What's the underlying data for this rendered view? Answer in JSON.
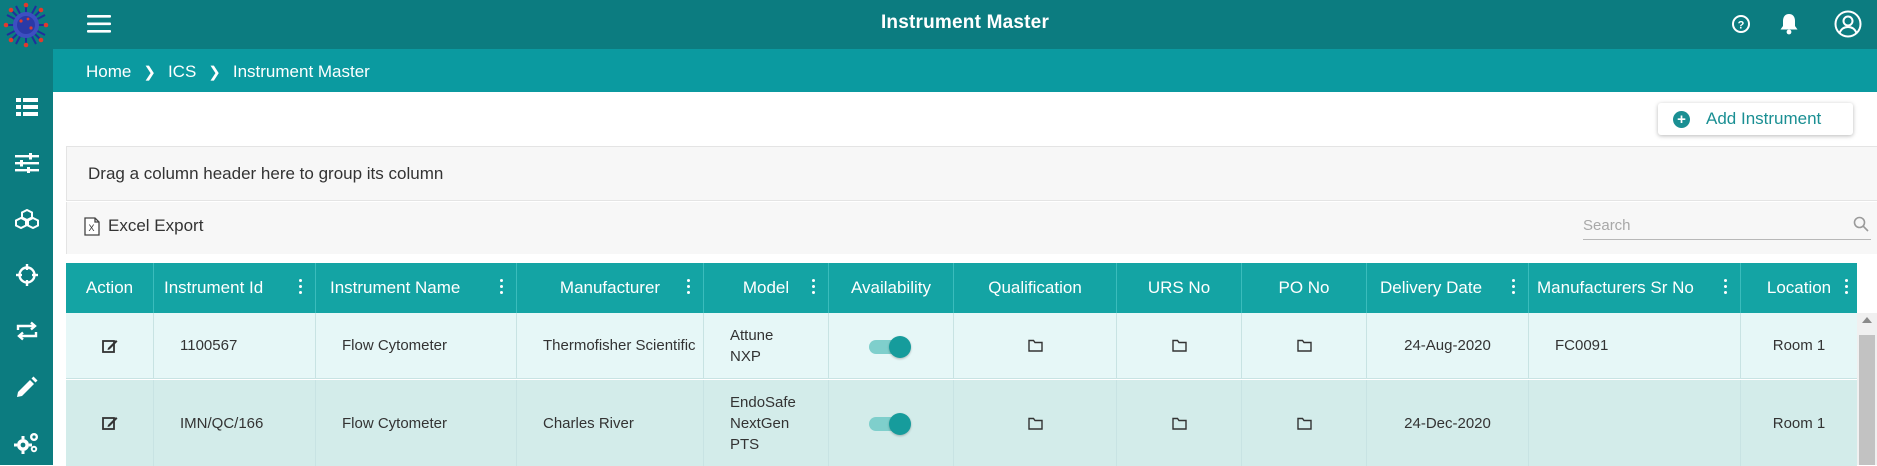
{
  "app": {
    "title": "Instrument Master"
  },
  "breadcrumb": [
    "Home",
    "ICS",
    "Instrument Master"
  ],
  "sidebar": {
    "icons": [
      "list-icon",
      "sliders-icon",
      "cubes-icon",
      "crosshair-icon",
      "sync-icon",
      "pencil-icon",
      "cogs-icon"
    ]
  },
  "topbar": {
    "icons": [
      "menu-icon",
      "help-icon",
      "bell-icon",
      "user-icon"
    ]
  },
  "toolbar": {
    "add_label": "Add Instrument",
    "group_hint": "Drag a column header here to group its column",
    "excel_label": "Excel Export",
    "search_placeholder": "Search"
  },
  "grid": {
    "columns": [
      {
        "label": "Action",
        "menu": false
      },
      {
        "label": "Instrument Id",
        "menu": true
      },
      {
        "label": "Instrument Name",
        "menu": true
      },
      {
        "label": "Manufacturer",
        "menu": true
      },
      {
        "label": "Model",
        "menu": true
      },
      {
        "label": "Availability",
        "menu": false
      },
      {
        "label": "Qualification",
        "menu": false
      },
      {
        "label": "URS No",
        "menu": false
      },
      {
        "label": "PO No",
        "menu": false
      },
      {
        "label": "Delivery Date",
        "menu": true
      },
      {
        "label": "Manufacturers Sr No",
        "menu": true
      },
      {
        "label": "Location",
        "menu": true
      }
    ],
    "rows": [
      {
        "instrument_id": "1100567",
        "instrument_name": "Flow Cytometer",
        "manufacturer": "Thermofisher Scientific",
        "model": "Attune NXP",
        "availability": true,
        "delivery_date": "24-Aug-2020",
        "manufacturer_sr_no": "FC0091",
        "location": "Room 1"
      },
      {
        "instrument_id": "IMN/QC/166",
        "instrument_name": "Flow Cytometer",
        "manufacturer": "Charles River",
        "model": "EndoSafe NextGen PTS",
        "availability": true,
        "delivery_date": "24-Dec-2020",
        "manufacturer_sr_no": "",
        "location": "Room 1"
      }
    ]
  },
  "colors": {
    "topbar": "#0c7c80",
    "breadcrumb_bar": "#0b9aa0",
    "grid_header": "#14a4a4",
    "row_odd": "#e6f7f7",
    "row_even": "#d3ecea",
    "accent": "#1a8f93"
  }
}
